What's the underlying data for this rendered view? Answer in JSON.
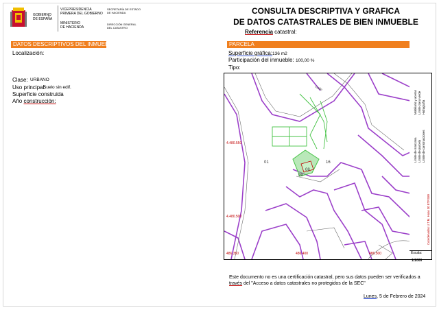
{
  "header": {
    "gov_name_1": "GOBIERNO",
    "gov_name_2": "DE ESPAÑA",
    "vice_1": "VICEPRESIDENCIA",
    "vice_2": "PRIMERA DEL GOBIERNO",
    "min_1": "MINISTERIO",
    "min_2": "DE HACIENDA",
    "sec_1": "SECRETARÍA DE ESTADO",
    "sec_2": "DE HACIENDA",
    "dir_1": "DIRECCIÓN GENERAL",
    "dir_2": "DEL CATASTRO"
  },
  "title": {
    "line1": "CONSULTA  DESCRIPTIVA  Y GRAFICA",
    "line2": "DE DATOS CATASTRALES  DE BIEN INMUEBLE",
    "ref_label_1": "Referencia",
    "ref_label_2": " catastral:"
  },
  "left": {
    "section": "DATOS DESCRIPTIVOS DEL INMUEBLE",
    "localizacion": "Localización:",
    "clase_label": "Clase:",
    "clase_value": "URBANO",
    "uso_label": "Uso principal:",
    "uso_value": "Suelo sin edif.",
    "superficie_label": "Superficie construida",
    "ano_label": "Año",
    "ano_label_2": "construcción:"
  },
  "right": {
    "section": "PARCELA",
    "sup_grafica_label": "Superficie gráfica:",
    "sup_grafica_value": "136 m2",
    "participacion_label": "Participación del inmueble:",
    "participacion_value": "100,00 %",
    "tipo_label": "Tipo:"
  },
  "map": {
    "labels": [
      "01",
      "09",
      "16",
      "08",
      "4.480.550",
      "4.480.500",
      "486.350",
      "486.400",
      "486.500",
      "Coordenadas U.T.M. Huso 30 ETRS89"
    ],
    "street": "Calle"
  },
  "legend": {
    "line1": "Límite de manzana",
    "line2": "Límite de parcela",
    "line3": "Límite de construcciones",
    "line4": "Mobiliario y aceras",
    "line5": "Límite zona verde",
    "line6": "Hidrografía",
    "scale_label": "Escala:",
    "scale_value": "1/1000"
  },
  "footer": {
    "line1": "Este documento no es una certificación catastral, pero sus datos pueden ser verificados a",
    "line2_a": "través",
    "line2_b": " del \"Acceso a datos catastrales no protegidos de la SEC\"",
    "date_a": "Lunes",
    "date_b": ", 5 de Febrero de 2024"
  },
  "colors": {
    "orange": "#f07f1e",
    "parcel_purple": "#9b3fc9",
    "green": "#43c243",
    "red_text": "#c00000"
  }
}
